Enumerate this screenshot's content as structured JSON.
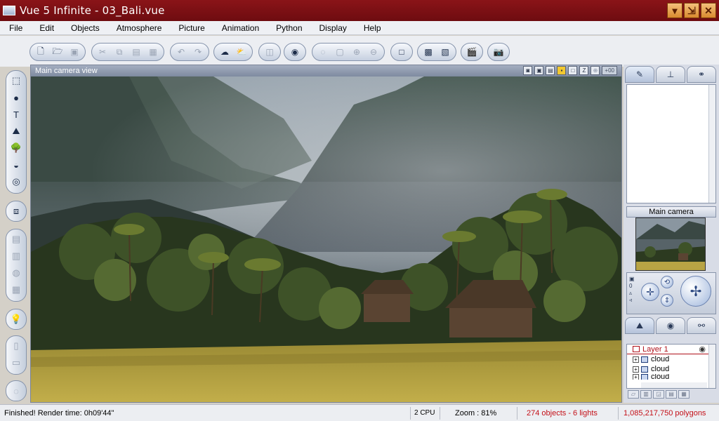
{
  "window": {
    "title": "Vue 5 Infinite - 03_Bali.vue",
    "controls": [
      "minimize",
      "restore",
      "close"
    ]
  },
  "menu": [
    "File",
    "Edit",
    "Objects",
    "Atmosphere",
    "Picture",
    "Animation",
    "Python",
    "Display",
    "Help"
  ],
  "viewport": {
    "title": "Main camera view",
    "zoom_tag": "+00"
  },
  "right_panel": {
    "camera_title": "Main camera",
    "layers": {
      "header": "Layer 1",
      "items": [
        "cloud",
        "cloud",
        "cloud"
      ]
    }
  },
  "status": {
    "message": "Finished! Render time: 0h09'44\"",
    "cpu": "2 CPU",
    "zoom": "Zoom : 81%",
    "objects": "274 objects - 6 lights",
    "polygons": "1,085,217,750 polygons"
  },
  "colors": {
    "titlebar": "#8a1418",
    "accent_red": "#c41018"
  }
}
